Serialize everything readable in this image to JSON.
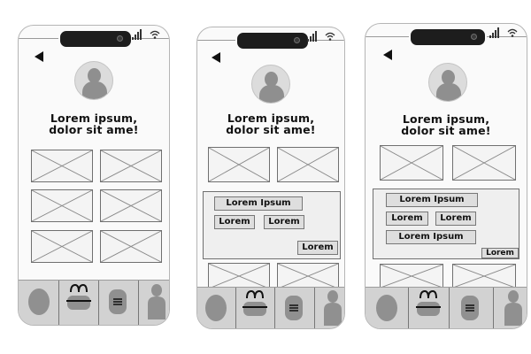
{
  "colors": {
    "frame": "#fafafa",
    "placeholder": "#f4f4f4",
    "chip": "#dedede",
    "tabbar": "#d2d2d2",
    "icon_fill": "#909090",
    "notch": "#1d1d1d"
  },
  "icons": {
    "back": "back-arrow-icon",
    "avatar": "user-avatar-icon",
    "signal": "signal-icon",
    "wifi": "wifi-icon",
    "tabs": [
      "home-blob-icon",
      "bag-icon",
      "menu-icon",
      "person-icon"
    ]
  },
  "screens": [
    {
      "headline": [
        "Lorem ipsum,",
        "dolor sit ame!"
      ],
      "image_grid_rows": 3,
      "has_panel": false
    },
    {
      "headline": [
        "Lorem ipsum,",
        "dolor sit ame!"
      ],
      "image_grid_rows": 1,
      "has_panel": true,
      "panel": {
        "chips": [
          "Lorem Ipsum",
          "Lorem",
          "Lorem"
        ],
        "action": "Lorem"
      }
    },
    {
      "headline": [
        "Lorem ipsum,",
        "dolor sit ame!"
      ],
      "image_grid_rows": 1,
      "has_panel": true,
      "panel": {
        "chips": [
          "Lorem Ipsum",
          "Lorem",
          "Lorem",
          "Lorem Ipsum"
        ],
        "action": "Lorem"
      }
    }
  ]
}
